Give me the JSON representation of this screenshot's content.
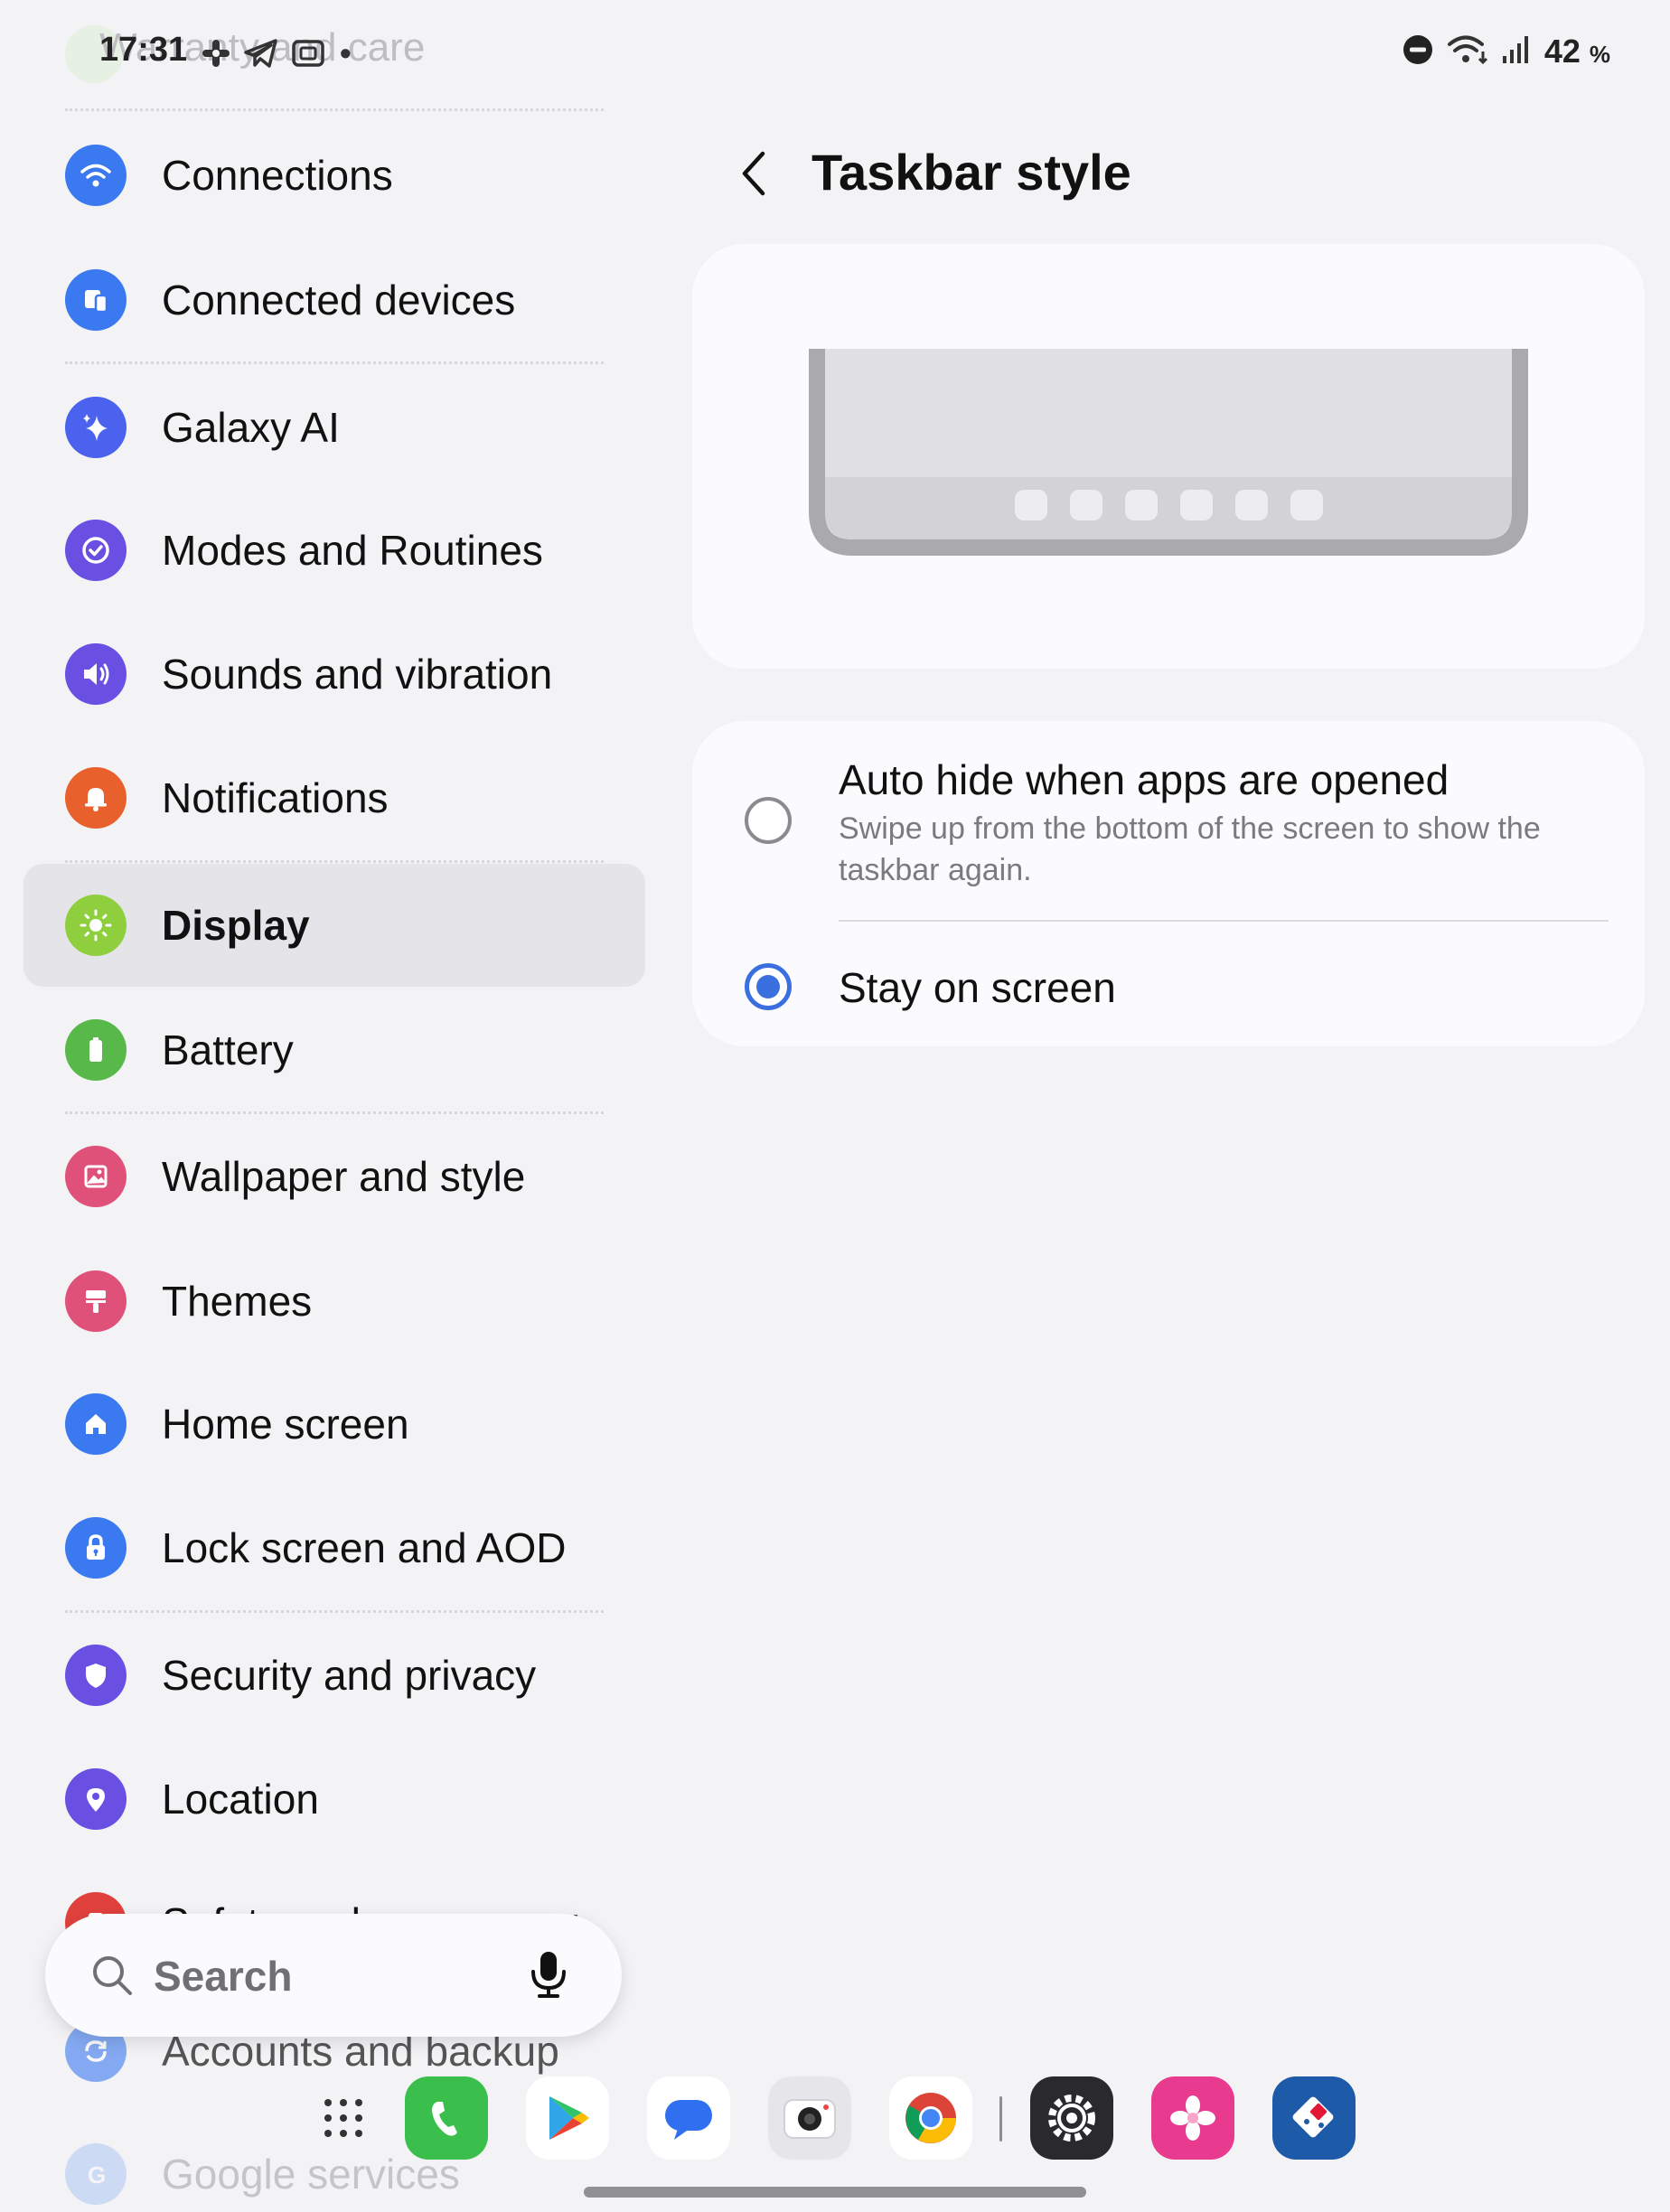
{
  "status_bar": {
    "time": "17:31",
    "dot": "•",
    "ghost_text": "Warranty and care",
    "battery": "42",
    "battery_unit": "%",
    "icons": [
      "slack-icon",
      "telegram-icon",
      "screenshot-icon",
      "dnd-icon",
      "wifi-icon",
      "signal-icon"
    ]
  },
  "sidebar": {
    "items": [
      {
        "label": "Connections",
        "icon": "wifi-icon",
        "color": "#3b79f0"
      },
      {
        "label": "Connected devices",
        "icon": "devices-icon",
        "color": "#3b79f0"
      },
      {
        "label": "Galaxy AI",
        "icon": "sparkle-icon",
        "color": "#4a62ee"
      },
      {
        "label": "Modes and Routines",
        "icon": "check-circle-icon",
        "color": "#6a4fe3"
      },
      {
        "label": "Sounds and vibration",
        "icon": "speaker-icon",
        "color": "#6a4fe3"
      },
      {
        "label": "Notifications",
        "icon": "bell-icon",
        "color": "#e8612c"
      },
      {
        "label": "Display",
        "icon": "sun-icon",
        "color": "#8fce3c",
        "active": true
      },
      {
        "label": "Battery",
        "icon": "battery-icon",
        "color": "#58b84a"
      },
      {
        "label": "Wallpaper and style",
        "icon": "image-icon",
        "color": "#e0517a"
      },
      {
        "label": "Themes",
        "icon": "paint-roller-icon",
        "color": "#e0517a"
      },
      {
        "label": "Home screen",
        "icon": "home-icon",
        "color": "#3b79f0"
      },
      {
        "label": "Lock screen and AOD",
        "icon": "lock-icon",
        "color": "#3b79f0"
      },
      {
        "label": "Security and privacy",
        "icon": "shield-icon",
        "color": "#6a4fe3"
      },
      {
        "label": "Location",
        "icon": "location-pin-icon",
        "color": "#6a4fe3"
      },
      {
        "label": "Safety and emergency",
        "icon": "emergency-icon",
        "color": "#e0413c"
      },
      {
        "label": "Accounts and backup",
        "icon": "sync-icon",
        "color": "#3b79f0"
      },
      {
        "label": "Google services",
        "icon": "google-icon",
        "color": "#3b79f0"
      }
    ]
  },
  "search": {
    "placeholder": "Search",
    "icon": "search-icon",
    "mic_icon": "mic-icon"
  },
  "page": {
    "title": "Taskbar style",
    "back_icon": "back-arrow-icon",
    "options": [
      {
        "title": "Auto hide when apps are opened",
        "description": "Swipe up from the bottom of the screen to show the taskbar again.",
        "checked": false
      },
      {
        "title": "Stay on screen",
        "checked": true
      }
    ]
  },
  "taskbar": {
    "apps": [
      "apps-grid-icon",
      "phone-app-icon",
      "play-store-icon",
      "messages-icon",
      "camera-icon",
      "chrome-icon",
      "settings-icon",
      "gallery-icon",
      "dominos-icon"
    ]
  },
  "colors": {
    "accent": "#3b6fe0",
    "background": "#f3f3f6",
    "card": "#fbfbfd"
  }
}
